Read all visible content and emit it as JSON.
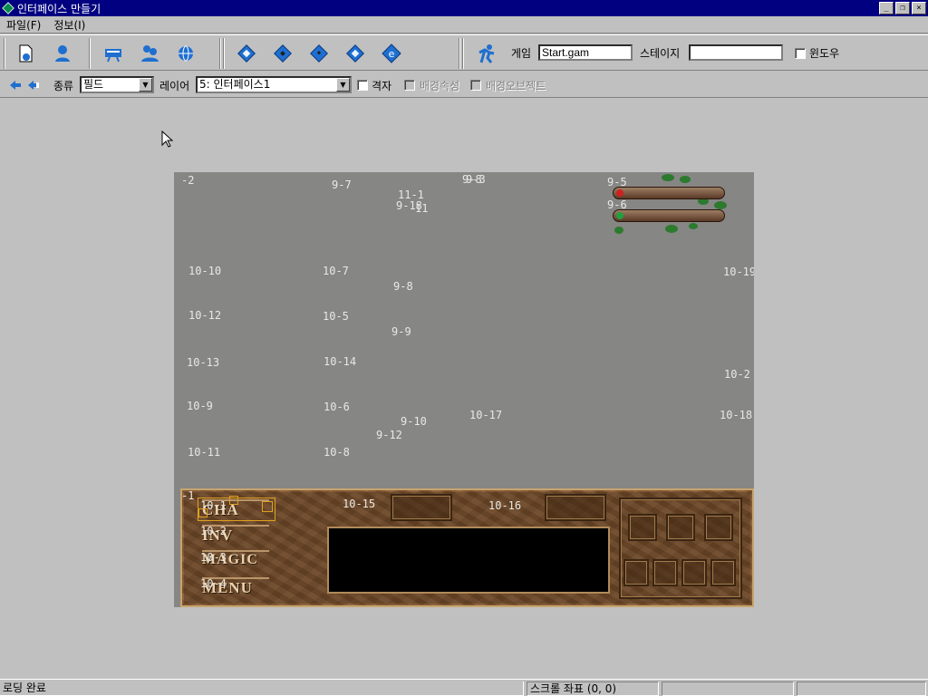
{
  "window": {
    "title": "인터페이스 만들기"
  },
  "menu": {
    "items": [
      "파일(F)",
      "정보(I)"
    ]
  },
  "toolbar": {
    "game_label": "게임",
    "game_value": "Start.gam",
    "stage_label": "스테이지",
    "stage_value": "",
    "window_checkbox_label": "윈도우",
    "window_checked": false
  },
  "toolbar2": {
    "kind_label": "종류",
    "kind_value": "필드",
    "layer_label": "레이어",
    "layer_value": "5: 인터페이스1",
    "grid_label": "격자",
    "grid_checked": false,
    "bg_attr_label": "배경속성",
    "bg_obj_label": "배경오브젝트"
  },
  "canvas": {
    "labels": {
      "l_m2": "-2",
      "l_9_7": "9-7",
      "l_11_1": "11-1",
      "l_9_a": "9-8",
      "l_9_b": "9-3",
      "l_9_18": "9-18",
      "l_11": "11",
      "l_9_5": "9-5",
      "l_9_6": "9-6",
      "l_10_10": "10-10",
      "l_10_7": "10-7",
      "l_9_8": "9-8",
      "l_10_19": "10-19",
      "l_10_12": "10-12",
      "l_10_5": "10-5",
      "l_9_9": "9-9",
      "l_10_13": "10-13",
      "l_10_14": "10-14",
      "l_10_2": "10-2",
      "l_10_9": "10-9",
      "l_10_6": "10-6",
      "l_9_10": "9-10",
      "l_10_17": "10-17",
      "l_10_18": "10-18",
      "l_9_12": "9-12",
      "l_10_11": "10-11",
      "l_10_8": "10-8",
      "l_m1": "-1",
      "l_10_15": "10-15",
      "l_10_16": "10-16",
      "l_10_1": "10-1",
      "l_10_2b": "10-2",
      "l_10_3": "10-3",
      "l_10_4": "10-4"
    },
    "buttons": {
      "cha": "CHA",
      "inv": "INV",
      "magic": "MAGIC",
      "menu": "MENU"
    }
  },
  "status": {
    "left": "로딩 완료",
    "scroll": "스크롤 좌표 (0, 0)",
    "pane3": "",
    "pane4": ""
  },
  "colors": {
    "titlebar": "#000080",
    "canvas_bg": "#868684",
    "panel": "#6e4a2a"
  },
  "icons": [
    "new-file-icon",
    "user-icon",
    "keyboard-icon",
    "people-icon",
    "globe-icon",
    "diamond-tool-icon",
    "diamond-tool-icon",
    "diamond-tool-icon",
    "diamond-tool-icon",
    "diamond-e-icon",
    "run-icon"
  ]
}
